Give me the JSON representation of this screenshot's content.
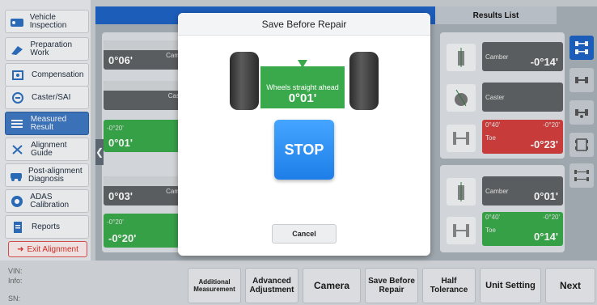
{
  "sidebar": {
    "items": [
      {
        "label": "Vehicle Inspection",
        "icon": "vehicle-inspection-icon"
      },
      {
        "label": "Preparation Work",
        "icon": "preparation-icon"
      },
      {
        "label": "Compensation",
        "icon": "compensation-icon"
      },
      {
        "label": "Caster/SAI",
        "icon": "caster-icon"
      },
      {
        "label": "Measured Result",
        "icon": "measured-result-icon"
      },
      {
        "label": "Alignment Guide",
        "icon": "alignment-guide-icon"
      },
      {
        "label": "Post-alignment Diagnosis",
        "icon": "post-alignment-icon"
      },
      {
        "label": "ADAS Calibration",
        "icon": "adas-icon"
      },
      {
        "label": "Reports",
        "icon": "reports-icon"
      }
    ],
    "exit_label": "Exit Alignment"
  },
  "results_title": "Results List",
  "left_gauges": [
    {
      "text": "0°06'",
      "small": "Cam"
    },
    {
      "text": "",
      "small": "Cas"
    },
    {
      "text": "0°01'",
      "small": "-0°20'"
    },
    {
      "text": "0°03'",
      "small": "Cam"
    },
    {
      "text": "-0°20'",
      "small": "-0°20'"
    }
  ],
  "results": [
    {
      "label": "Camber",
      "value": "-0°14'",
      "color": "#5f6265"
    },
    {
      "label": "Caster",
      "value": "",
      "color": "#5f6265"
    },
    {
      "label": "Toe",
      "value": "-0°23'",
      "color": "#d2403f",
      "limits": [
        "0°40'",
        "-0°20'"
      ]
    },
    {
      "label": "Camber",
      "value": "0°01'",
      "color": "#5f6265"
    },
    {
      "label": "Toe",
      "value": "0°14'",
      "color": "#39a94b",
      "limits": [
        "0°40'",
        "-0°20'"
      ]
    }
  ],
  "bottom": {
    "vin_label": "VIN:",
    "info_label": "Info:",
    "sn_label": "SN:",
    "buttons": [
      "Additional Measurement",
      "Advanced Adjustment",
      "Camera",
      "Save Before Repair",
      "Half Tolerance",
      "Unit Setting",
      "Next"
    ]
  },
  "modal": {
    "title": "Save Before Repair",
    "wheels_label": "Wheels straight ahead",
    "wheels_value": "0°01'",
    "stop_label": "STOP",
    "cancel_label": "Cancel"
  },
  "colors": {
    "accent_blue": "#1e63c5",
    "green": "#39a94b",
    "red": "#d2403f"
  }
}
